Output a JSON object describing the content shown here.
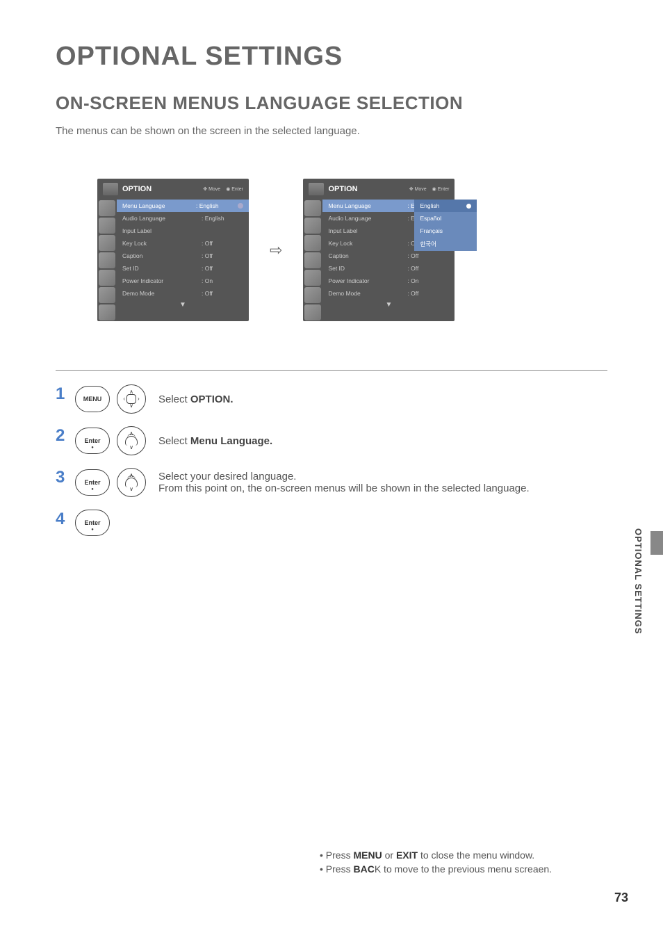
{
  "title": "OPTIONAL SETTINGS",
  "section": "ON-SCREEN MENUS LANGUAGE SELECTION",
  "intro": "The menus can be shown on the screen in the selected language.",
  "osd": {
    "header_title": "OPTION",
    "hint_move": "Move",
    "hint_enter": "Enter",
    "rows": [
      {
        "label": "Menu Language",
        "value": ": English"
      },
      {
        "label": "Audio Language",
        "value": ": English"
      },
      {
        "label": "Input Label",
        "value": ""
      },
      {
        "label": "Key Lock",
        "value": ": Off"
      },
      {
        "label": "Caption",
        "value": ": Off"
      },
      {
        "label": "Set ID",
        "value": ": Off"
      },
      {
        "label": "Power Indicator",
        "value": ": On"
      },
      {
        "label": "Demo Mode",
        "value": ": Off"
      }
    ],
    "foot": "▼",
    "dropdown": [
      "English",
      "Español",
      "Français",
      "한국어"
    ]
  },
  "arrow": "⇨",
  "steps": {
    "s1": {
      "num": "1",
      "btn": "MENU",
      "text_pre": "Select ",
      "bold": "OPTION.",
      "text_post": ""
    },
    "s2": {
      "num": "2",
      "btn": "Enter",
      "text_pre": "Select ",
      "bold": "Menu Language.",
      "text_post": ""
    },
    "s3": {
      "num": "3",
      "btn": "Enter",
      "line1": "Select your desired language.",
      "line2": "From this point on, the on-screen menus will be shown in the selected language."
    },
    "s4": {
      "num": "4",
      "btn": "Enter"
    }
  },
  "side_tab": "OPTIONAL SETTINGS",
  "notes": {
    "l1a": "Press ",
    "l1b": "MENU",
    "l1c": " or ",
    "l1d": "EXIT",
    "l1e": " to close the menu window.",
    "l2a": "Press ",
    "l2b": "BAC",
    "l2c": "K to move to the previous menu screaen."
  },
  "page_num": "73"
}
